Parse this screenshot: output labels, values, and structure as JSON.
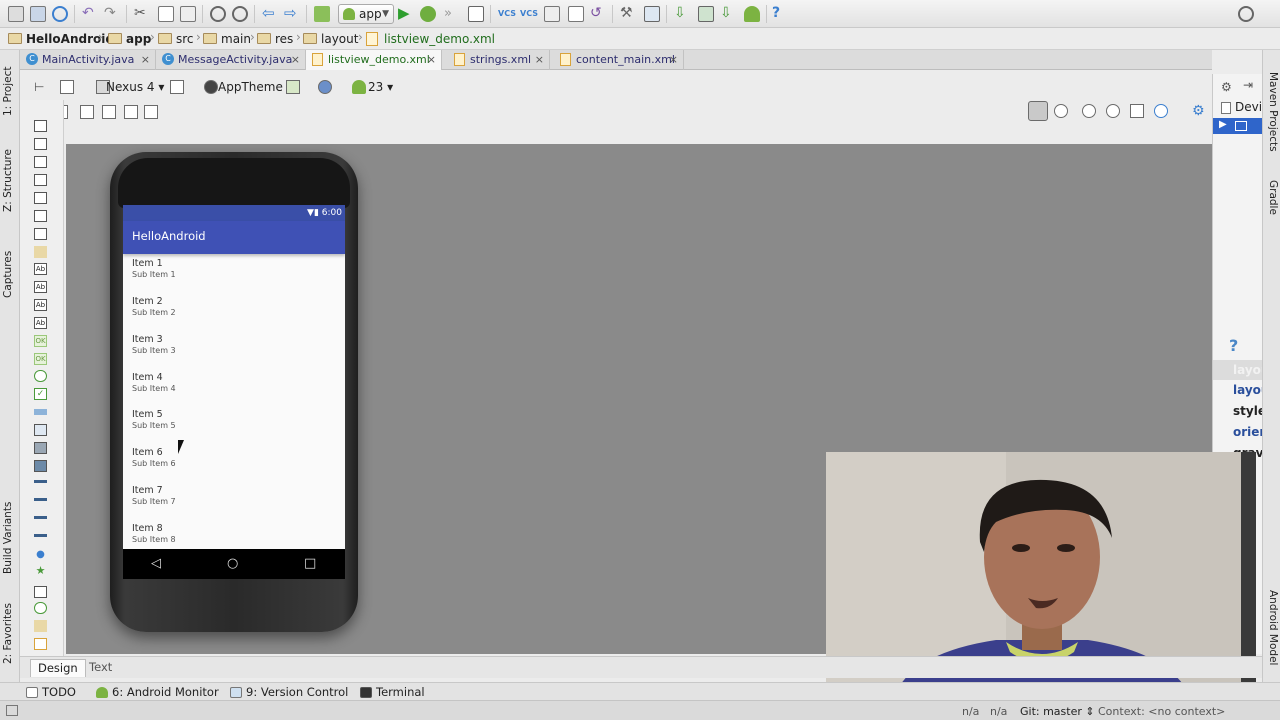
{
  "toolbar": {
    "run_config": "app"
  },
  "breadcrumb": [
    "HelloAndroid",
    "app",
    "src",
    "main",
    "res",
    "layout",
    "listview_demo.xml"
  ],
  "tabs": [
    {
      "label": "MainActivity.java"
    },
    {
      "label": "MessageActivity.java"
    },
    {
      "label": "listview_demo.xml"
    },
    {
      "label": "strings.xml"
    },
    {
      "label": "content_main.xml"
    }
  ],
  "left_strip": {
    "project": "1: Project",
    "structure": "Z: Structure",
    "captures": "Captures",
    "build_variants": "Build Variants",
    "favorites": "2: Favorites"
  },
  "right_strip": {
    "maven": "Maven Projects",
    "gradle": "Gradle",
    "android_model": "Android Model"
  },
  "design_toolbar": {
    "device": "Nexus 4",
    "theme": "AppTheme",
    "api": "23"
  },
  "phone": {
    "status_time": "6:00",
    "app_title": "HelloAndroid",
    "items": [
      {
        "title": "Item 1",
        "sub": "Sub Item 1"
      },
      {
        "title": "Item 2",
        "sub": "Sub Item 2"
      },
      {
        "title": "Item 3",
        "sub": "Sub Item 3"
      },
      {
        "title": "Item 4",
        "sub": "Sub Item 4"
      },
      {
        "title": "Item 5",
        "sub": "Sub Item 5"
      },
      {
        "title": "Item 6",
        "sub": "Sub Item 6"
      },
      {
        "title": "Item 7",
        "sub": "Sub Item 7"
      },
      {
        "title": "Item 8",
        "sub": "Sub Item 8"
      }
    ]
  },
  "right_panel": {
    "device_label": "Devi",
    "help": "?",
    "props": [
      "layou",
      "layou",
      "style",
      "orien",
      "gravi"
    ]
  },
  "design_tabs": {
    "design": "Design",
    "text": "Text"
  },
  "tool_windows": {
    "todo": "TODO",
    "android_monitor": "6: Android Monitor",
    "version_control": "9: Version Control",
    "terminal": "Terminal"
  },
  "status": {
    "na1": "n/a",
    "na2": "n/a",
    "git": "Git: master",
    "context": "Context: <no context>"
  }
}
